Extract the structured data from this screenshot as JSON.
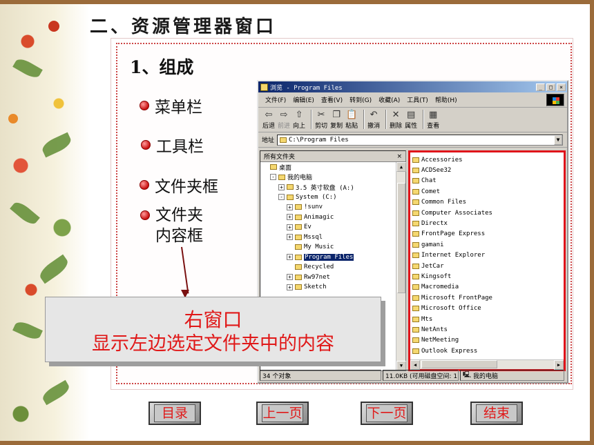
{
  "slide": {
    "title": "二、资源管理器窗口",
    "subtitle": "1、组成",
    "bullets": [
      "菜单栏",
      "工具栏",
      "文件夹框"
    ],
    "bullet_multi": {
      "line1": "文件夹",
      "line2": "内容框"
    }
  },
  "explorer": {
    "title": "浏览 - Program Files",
    "window_buttons": {
      "minimize": "_",
      "maximize": "□",
      "close": "×"
    },
    "menu": [
      "文件(F)",
      "编辑(E)",
      "查看(V)",
      "转到(G)",
      "收藏(A)",
      "工具(T)",
      "帮助(H)"
    ],
    "toolbar": [
      {
        "label": "后退",
        "icon": "⇦"
      },
      {
        "label": "前进",
        "icon": "⇨"
      },
      {
        "label": "向上",
        "icon": "⇧"
      },
      {
        "label": "剪切",
        "icon": "✂"
      },
      {
        "label": "复制",
        "icon": "❐"
      },
      {
        "label": "粘贴",
        "icon": "📋"
      },
      {
        "label": "撤消",
        "icon": "↶"
      },
      {
        "label": "删除",
        "icon": "✕"
      },
      {
        "label": "属性",
        "icon": "▤"
      },
      {
        "label": "查看",
        "icon": "▦"
      }
    ],
    "address": {
      "label": "地址",
      "value": "C:\\Program Files"
    },
    "tree_header": "所有文件夹",
    "tree_close": "×",
    "tree": [
      {
        "label": "桌面",
        "pm": "",
        "indent": 0
      },
      {
        "label": "我的电脑",
        "pm": "-",
        "indent": 1
      },
      {
        "label": "3.5 英寸软盘 (A:)",
        "pm": "+",
        "indent": 2
      },
      {
        "label": "System (C:)",
        "pm": "-",
        "indent": 2
      },
      {
        "label": "!sunv",
        "pm": "+",
        "indent": 3
      },
      {
        "label": "Animagic",
        "pm": "+",
        "indent": 3
      },
      {
        "label": "Ev",
        "pm": "+",
        "indent": 3
      },
      {
        "label": "Mssql",
        "pm": "+",
        "indent": 3
      },
      {
        "label": "My Music",
        "pm": "",
        "indent": 3
      },
      {
        "label": "Program Files",
        "pm": "+",
        "indent": 3,
        "selected": true
      },
      {
        "label": "Recycled",
        "pm": "",
        "indent": 3
      },
      {
        "label": "Rw97net",
        "pm": "+",
        "indent": 3
      },
      {
        "label": "Sketch",
        "pm": "+",
        "indent": 3
      }
    ],
    "files": [
      "Accessories",
      "ACDSee32",
      "Chat",
      "Comet",
      "Common Files",
      "Computer Associates",
      "Directx",
      "FrontPage Express",
      "gamani",
      "Internet Explorer",
      "JetCar",
      "Kingsoft",
      "Macromedia",
      "Microsoft FrontPage",
      "Microsoft Office",
      "Mts",
      "NetAnts",
      "NetMeeting",
      "Outlook Express"
    ],
    "status": {
      "count": "34 个对象",
      "space": "11.0KB (可用磁盘空间: 1.",
      "location": "我的电脑"
    }
  },
  "callout": {
    "line1": "右窗口",
    "line2": "显示左边选定文件夹中的内容"
  },
  "nav": {
    "toc": "目录",
    "prev": "上一页",
    "next": "下一页",
    "end": "结束"
  },
  "colors": {
    "accent_red": "#e01818",
    "highlight_border": "#e0131a",
    "titlebar": "#0a246a"
  }
}
